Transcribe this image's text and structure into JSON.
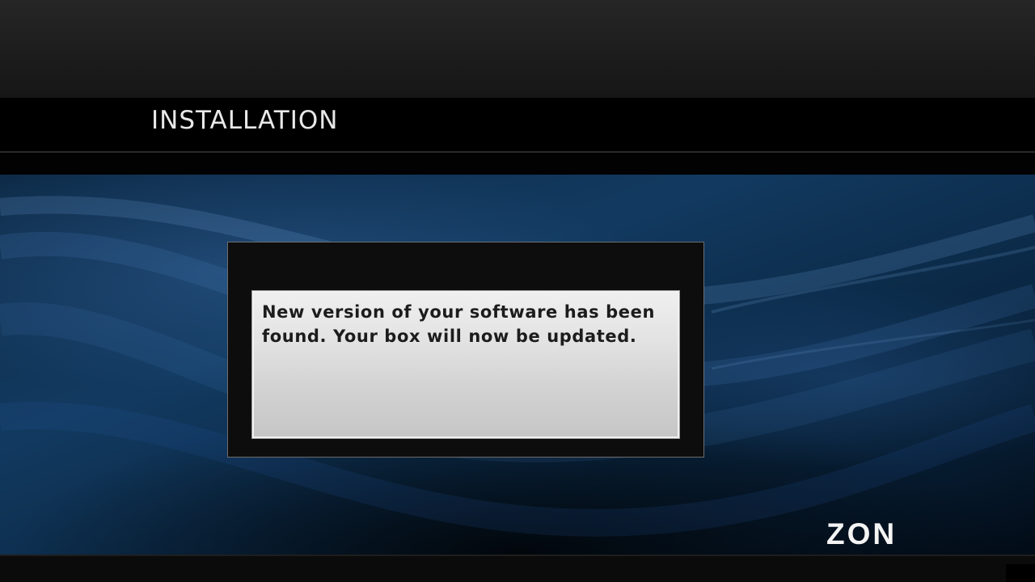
{
  "header": {
    "title": "INSTALLATION"
  },
  "dialog": {
    "message": "New version of your software has been found. Your box will now be updated."
  },
  "brand": {
    "logo_text": "ZON"
  },
  "colors": {
    "background_blue": "#123a60",
    "title_text": "#e8e8e8",
    "dialog_frame": "#0d0d0d",
    "message_box": "#d9d9d9",
    "message_text": "#1c1c1c"
  }
}
